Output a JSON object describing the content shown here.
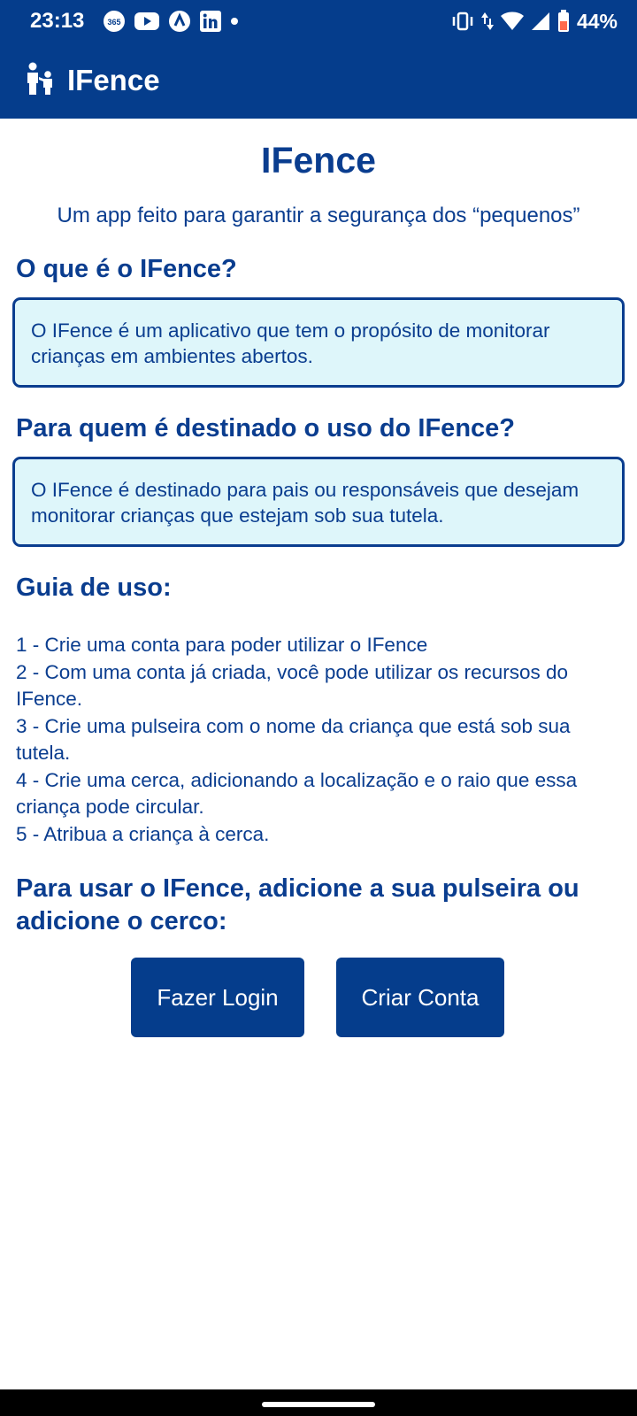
{
  "status_bar": {
    "time": "23:13",
    "left_icons": [
      "365-icon",
      "youtube-icon",
      "arrow-app-icon",
      "linkedin-icon",
      "dot-icon"
    ],
    "battery_percent": "44%",
    "right_icons": [
      "vibrate-icon",
      "data-arrows-icon",
      "wifi-icon",
      "signal-icon",
      "battery-icon"
    ]
  },
  "app_bar": {
    "title": "IFence",
    "logo_icon": "parent-child-icon"
  },
  "main": {
    "title": "IFence",
    "subtitle": "Um app feito para garantir a segurança dos “pequenos”",
    "sections": [
      {
        "heading": "O que é o IFence?",
        "text": "O IFence é um aplicativo que tem o propósito de monitorar crianças em ambientes abertos."
      },
      {
        "heading": "Para quem é destinado o uso do IFence?",
        "text": "O IFence é destinado para pais ou responsáveis que desejam monitorar crianças que estejam sob sua tutela."
      }
    ],
    "guide": {
      "heading": "Guia de uso:",
      "steps": [
        "1 - Crie uma conta para poder utilizar o IFence",
        "2 - Com uma conta já criada, você pode utilizar os recursos do IFence.",
        "3 - Crie uma pulseira com o nome da criança que está sob sua tutela.",
        "4 - Crie uma cerca, adicionando a localização e o raio que essa criança pode circular.",
        "5 - Atribua a criança à cerca."
      ]
    },
    "cta": {
      "heading": "Para usar o IFence, adicione a sua pulseira ou adicione o cerco:",
      "login_label": "Fazer Login",
      "create_label": "Criar Conta"
    }
  },
  "colors": {
    "primary": "#053d8c",
    "text": "#0a3d8f",
    "box_background": "#def6fa"
  }
}
